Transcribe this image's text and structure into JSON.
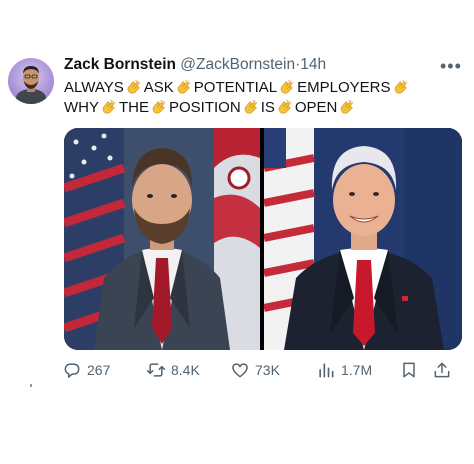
{
  "tweet": {
    "author_name": "Zack Bornstein",
    "author_handle": "@ZackBornstein",
    "separator": "·",
    "time": "14h",
    "text_words": [
      "ALWAYS",
      "ASK",
      "POTENTIAL",
      "EMPLOYERS",
      "WHY",
      "THE",
      "POSITION",
      "IS",
      "OPEN"
    ],
    "emoji": "clapping-hands-emoji"
  },
  "media": {
    "left_photo": "portrait-man-beard-flag",
    "right_photo": "portrait-man-white-hair-flag"
  },
  "actions": {
    "replies": "267",
    "retweets": "8.4K",
    "likes": "73K",
    "views": "1.7M"
  },
  "colors": {
    "text": "#0f1419",
    "muted": "#536471",
    "avatar_bg": "#a892d8"
  },
  "icons": [
    "more-icon",
    "reply-icon",
    "retweet-icon",
    "like-icon",
    "views-icon",
    "bookmark-icon",
    "share-icon"
  ]
}
